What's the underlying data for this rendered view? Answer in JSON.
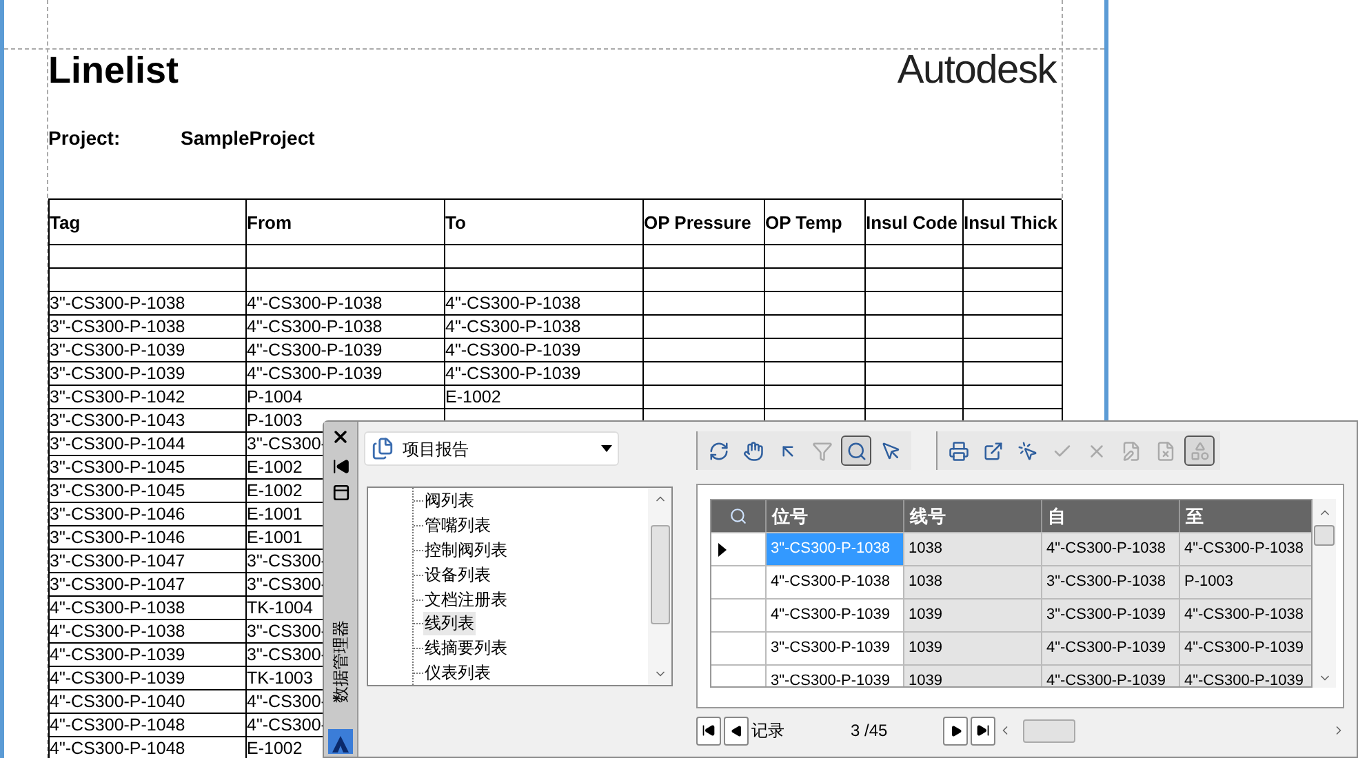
{
  "document": {
    "title": "Linelist",
    "logo": "Autodesk",
    "project_label": "Project:",
    "project_value": "SampleProject",
    "columns": [
      "Tag",
      "From",
      "To",
      "OP Pressure",
      "OP Temp",
      "Insul Code",
      "Insul Thick"
    ],
    "rows": [
      {
        "cells": []
      },
      {
        "cells": []
      },
      {
        "cells": [
          "3\"-CS300-P-1038",
          "4\"-CS300-P-1038",
          "4\"-CS300-P-1038"
        ]
      },
      {
        "cells": [
          "3\"-CS300-P-1038",
          "4\"-CS300-P-1038",
          "4\"-CS300-P-1038"
        ]
      },
      {
        "cells": [
          "3\"-CS300-P-1039",
          "4\"-CS300-P-1039",
          "4\"-CS300-P-1039"
        ]
      },
      {
        "cells": [
          "3\"-CS300-P-1039",
          "4\"-CS300-P-1039",
          "4\"-CS300-P-1039"
        ]
      },
      {
        "cells": [
          "3\"-CS300-P-1042",
          "P-1004",
          "E-1002"
        ]
      },
      {
        "cells": [
          "3\"-CS300-P-1043",
          "P-1003"
        ]
      },
      {
        "cells": [
          "3\"-CS300-P-1044",
          "3\"-CS300-"
        ]
      },
      {
        "cells": [
          "3\"-CS300-P-1045",
          "E-1002"
        ]
      },
      {
        "cells": [
          "3\"-CS300-P-1045",
          "E-1002"
        ]
      },
      {
        "cells": [
          "3\"-CS300-P-1046",
          "E-1001"
        ]
      },
      {
        "cells": [
          "3\"-CS300-P-1046",
          "E-1001"
        ]
      },
      {
        "cells": [
          "3\"-CS300-P-1047",
          "3\"-CS300-"
        ]
      },
      {
        "cells": [
          "3\"-CS300-P-1047",
          "3\"-CS300-"
        ]
      },
      {
        "cells": [
          "4\"-CS300-P-1038",
          "TK-1004"
        ]
      },
      {
        "cells": [
          "4\"-CS300-P-1038",
          "3\"-CS300-"
        ]
      },
      {
        "cells": [
          "4\"-CS300-P-1039",
          "3\"-CS300-"
        ]
      },
      {
        "cells": [
          "4\"-CS300-P-1039",
          "TK-1003"
        ]
      },
      {
        "cells": [
          "4\"-CS300-P-1040",
          "4\"-CS300-"
        ]
      },
      {
        "cells": [
          "4\"-CS300-P-1048",
          "4\"-CS300-"
        ]
      },
      {
        "cells": [
          "4\"-CS300-P-1048",
          "E-1002"
        ]
      }
    ]
  },
  "panel": {
    "side_title": "数据管理器",
    "report_select": "项目报告",
    "tree": [
      {
        "label": "阀列表",
        "selected": false
      },
      {
        "label": "管嘴列表",
        "selected": false
      },
      {
        "label": "控制阀列表",
        "selected": false
      },
      {
        "label": "设备列表",
        "selected": false
      },
      {
        "label": "文档注册表",
        "selected": false
      },
      {
        "label": "线列表",
        "selected": true
      },
      {
        "label": "线摘要列表",
        "selected": false
      },
      {
        "label": "仪表列表",
        "selected": false
      }
    ],
    "toolbar_groups": [
      [
        {
          "disabled": false,
          "pressed": false
        },
        {
          "disabled": false,
          "pressed": false
        },
        {
          "disabled": false,
          "pressed": false
        },
        {
          "disabled": true,
          "pressed": false
        },
        {
          "disabled": false,
          "pressed": true
        },
        {
          "disabled": false,
          "pressed": false
        }
      ],
      [
        {
          "disabled": false,
          "pressed": false
        },
        {
          "disabled": false,
          "pressed": false
        },
        {
          "disabled": false,
          "pressed": false
        },
        {
          "disabled": true,
          "pressed": false
        },
        {
          "disabled": true,
          "pressed": false
        },
        {
          "disabled": true,
          "pressed": false
        },
        {
          "disabled": true,
          "pressed": false
        },
        {
          "disabled": true,
          "pressed": true
        }
      ]
    ],
    "grid": {
      "columns": [
        "位号",
        "线号",
        "自",
        "至"
      ],
      "rows": [
        {
          "current": true,
          "cells": [
            {
              "text": "3\"-CS300-P-1038",
              "selected": true
            },
            {
              "text": "1038",
              "selected": false
            },
            {
              "text": "4\"-CS300-P-1038",
              "selected": false
            },
            {
              "text": "4\"-CS300-P-1038",
              "selected": false
            }
          ]
        },
        {
          "current": false,
          "cells": [
            {
              "text": "4\"-CS300-P-1038",
              "selected": false
            },
            {
              "text": "1038",
              "selected": false
            },
            {
              "text": "3\"-CS300-P-1038",
              "selected": false
            },
            {
              "text": "P-1003",
              "selected": false
            }
          ]
        },
        {
          "current": false,
          "cells": [
            {
              "text": "4\"-CS300-P-1039",
              "selected": false
            },
            {
              "text": "1039",
              "selected": false
            },
            {
              "text": "3\"-CS300-P-1039",
              "selected": false
            },
            {
              "text": "4\"-CS300-P-1038",
              "selected": false
            }
          ]
        },
        {
          "current": false,
          "cells": [
            {
              "text": "3\"-CS300-P-1039",
              "selected": false
            },
            {
              "text": "1039",
              "selected": false
            },
            {
              "text": "4\"-CS300-P-1039",
              "selected": false
            },
            {
              "text": "4\"-CS300-P-1039",
              "selected": false
            }
          ]
        },
        {
          "current": false,
          "cells": [
            {
              "text": "3\"-CS300-P-1039",
              "selected": false
            },
            {
              "text": "1039",
              "selected": false
            },
            {
              "text": "4\"-CS300-P-1039",
              "selected": false
            },
            {
              "text": "4\"-CS300-P-1039",
              "selected": false
            }
          ]
        }
      ]
    },
    "nav": {
      "label": "记录",
      "position": "3 /45"
    }
  }
}
